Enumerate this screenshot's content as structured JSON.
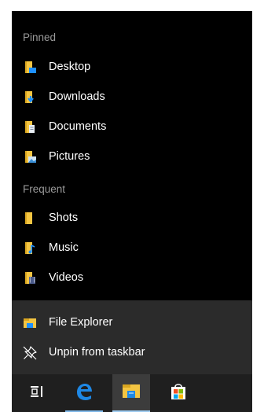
{
  "jumplist": {
    "pinned_header": "Pinned",
    "pinned": [
      {
        "label": "Desktop",
        "icon": "desktop-folder-icon"
      },
      {
        "label": "Downloads",
        "icon": "downloads-folder-icon"
      },
      {
        "label": "Documents",
        "icon": "documents-folder-icon"
      },
      {
        "label": "Pictures",
        "icon": "pictures-folder-icon"
      }
    ],
    "frequent_header": "Frequent",
    "frequent": [
      {
        "label": "Shots",
        "icon": "folder-icon"
      },
      {
        "label": "Music",
        "icon": "music-folder-icon"
      },
      {
        "label": "Videos",
        "icon": "videos-folder-icon"
      }
    ],
    "tasks": [
      {
        "label": "File Explorer",
        "icon": "file-explorer-icon"
      },
      {
        "label": "Unpin from taskbar",
        "icon": "unpin-icon"
      }
    ]
  },
  "taskbar": {
    "buttons": [
      {
        "name": "task-view",
        "icon": "task-view-icon"
      },
      {
        "name": "edge",
        "icon": "edge-icon"
      },
      {
        "name": "file-explorer",
        "icon": "file-explorer-icon"
      },
      {
        "name": "store",
        "icon": "store-icon"
      }
    ]
  },
  "colors": {
    "panel_bg": "#000000",
    "tasks_bg": "#2b2b2b",
    "taskbar_bg": "#1f1f1f",
    "header_text": "#9a9a9a",
    "item_text": "#ffffff",
    "folder_yellow": "#f4c542",
    "accent_blue": "#0078d7"
  }
}
